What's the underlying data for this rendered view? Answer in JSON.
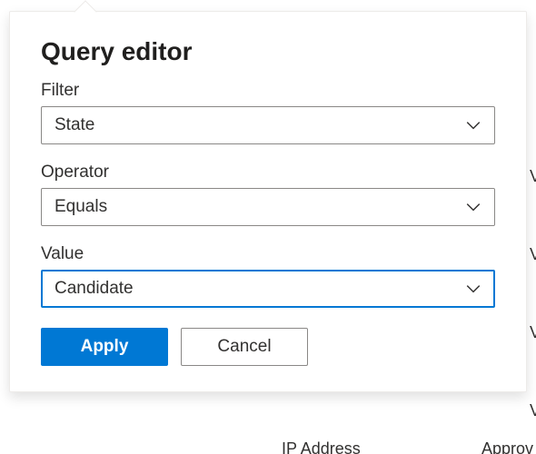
{
  "panel": {
    "title": "Query editor",
    "filter_label": "Filter",
    "filter_value": "State",
    "operator_label": "Operator",
    "operator_value": "Equals",
    "value_label": "Value",
    "value_value": "Candidate",
    "apply_label": "Apply",
    "cancel_label": "Cancel"
  },
  "background": {
    "ip_label": "IP Address",
    "approv": "Approv",
    "v": "V"
  }
}
